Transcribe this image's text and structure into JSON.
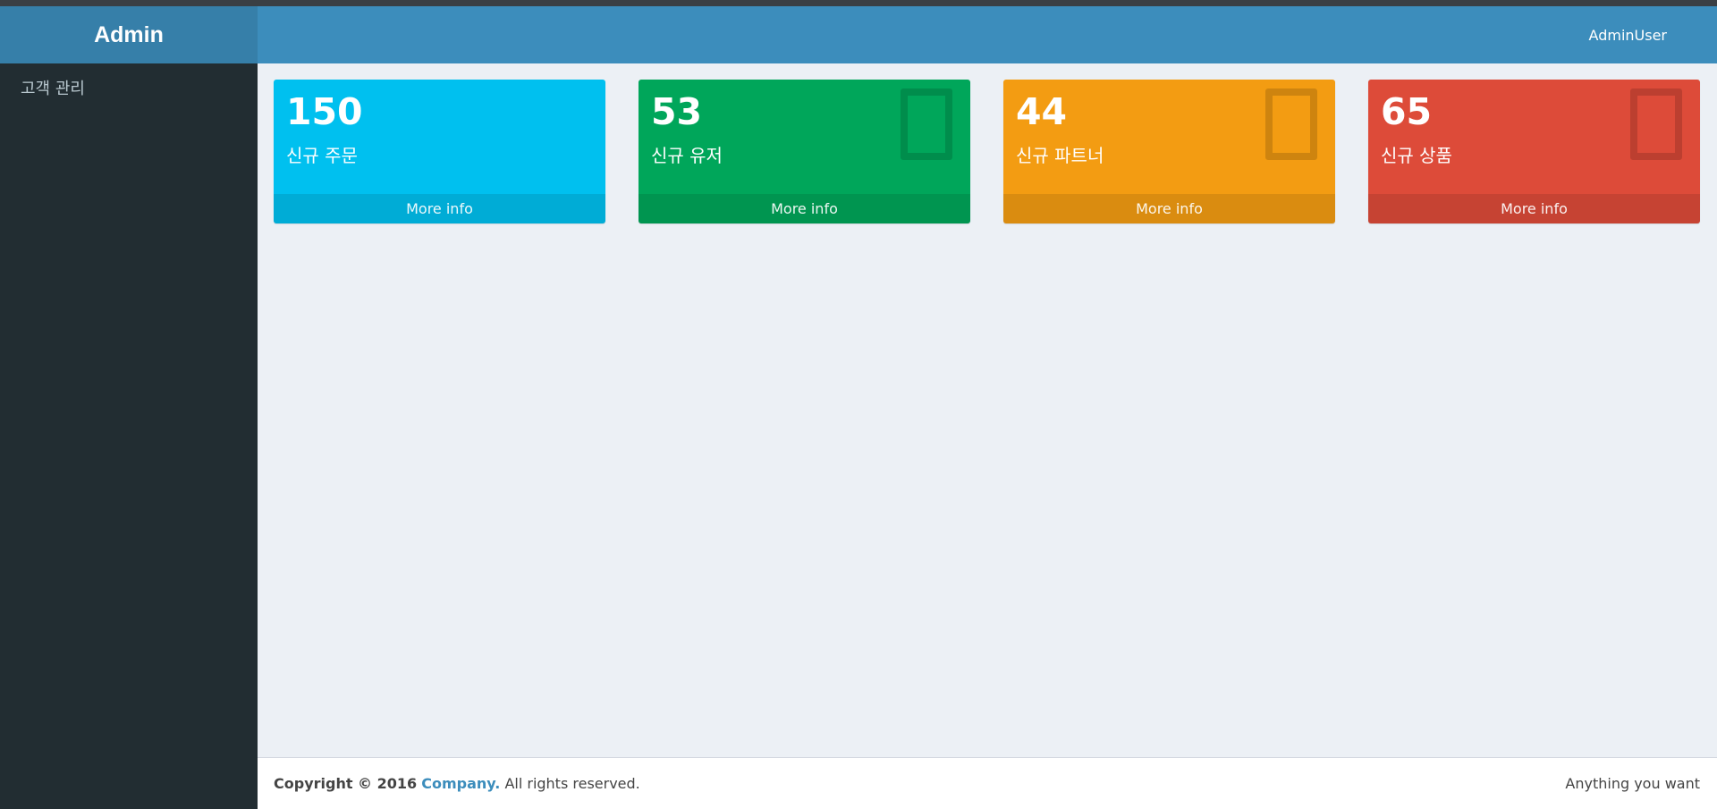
{
  "header": {
    "logo": "Admin",
    "user": "AdminUser"
  },
  "sidebar": {
    "items": [
      {
        "label": "고객 관리"
      }
    ]
  },
  "boxes": [
    {
      "value": "150",
      "label": "신규 주문",
      "footer": "More info",
      "color": "#00c0ef"
    },
    {
      "value": "53",
      "label": "신규 유저",
      "footer": "More info",
      "color": "#00a65a"
    },
    {
      "value": "44",
      "label": "신규 파트너",
      "footer": "More info",
      "color": "#f39c12"
    },
    {
      "value": "65",
      "label": "신규 상품",
      "footer": "More info",
      "color": "#dd4b39"
    }
  ],
  "footer": {
    "copyright_prefix": "Copyright © 2016",
    "company": "Company.",
    "rights": "All rights reserved.",
    "right_text": "Anything you want"
  },
  "colors": {
    "header": "#3c8dbc",
    "logo_bg": "#367fa9",
    "sidebar": "#222d32",
    "content_bg": "#ecf0f5"
  }
}
